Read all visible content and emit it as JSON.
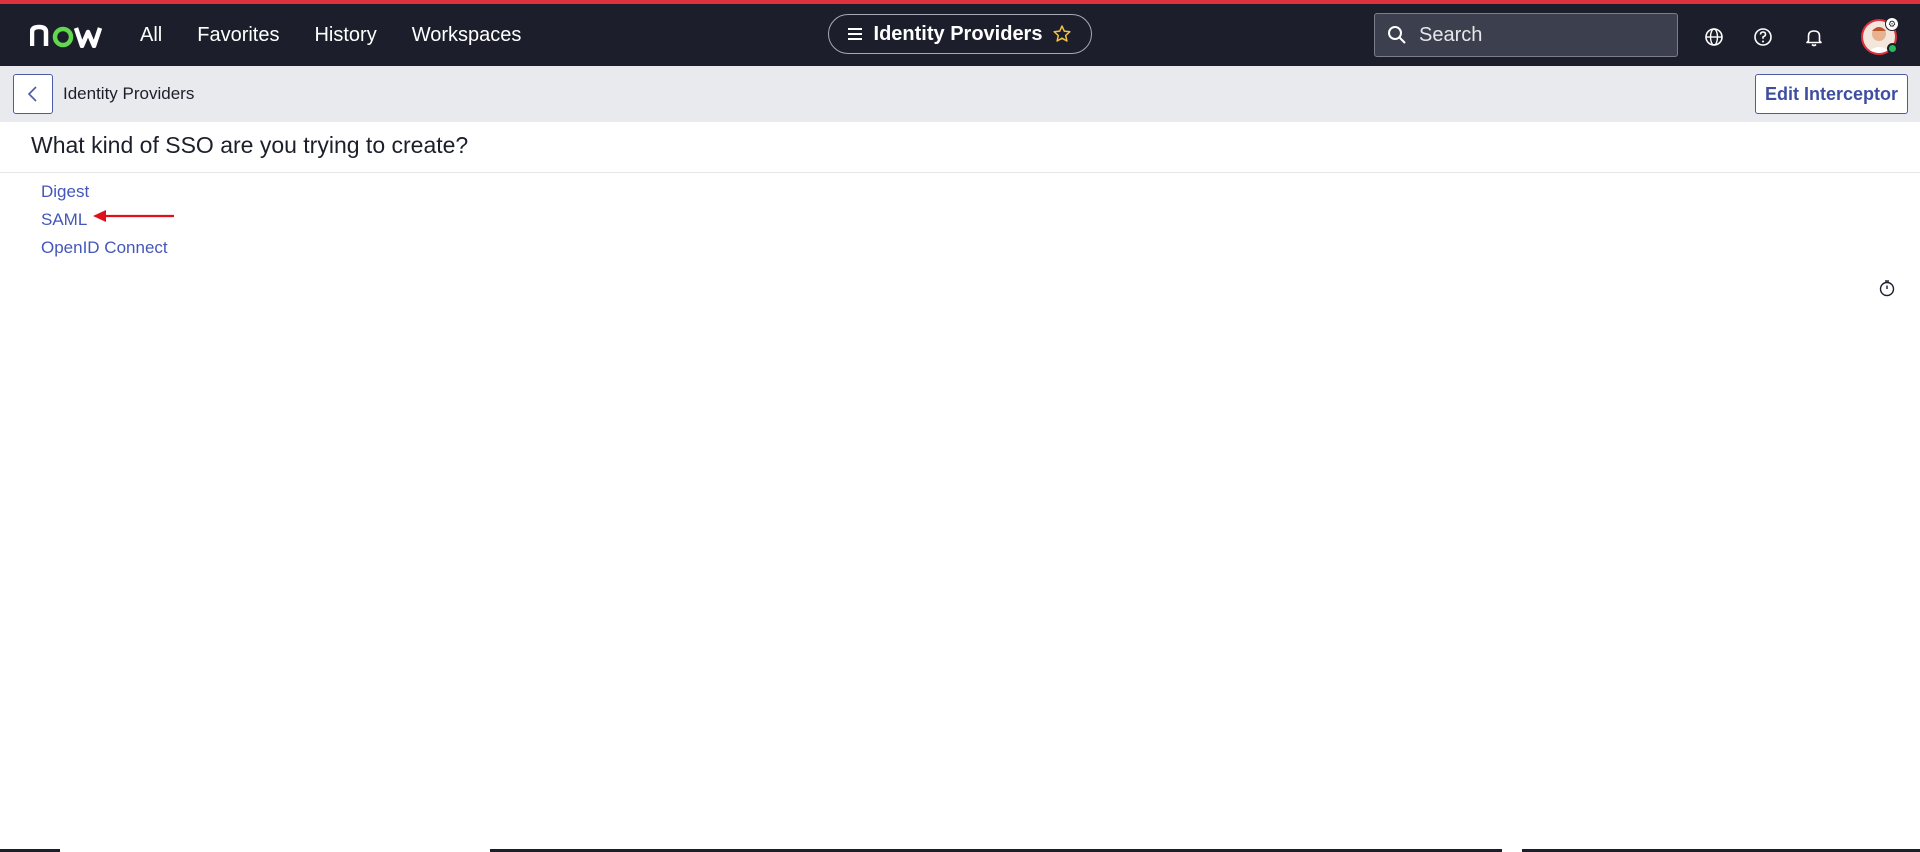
{
  "topbar": {
    "logo_text": "now",
    "nav": [
      "All",
      "Favorites",
      "History",
      "Workspaces"
    ],
    "page_title": "Identity Providers",
    "search_placeholder": "Search",
    "accent_color": "#e0313f",
    "bar_color": "#1c1f2b"
  },
  "subbar": {
    "breadcrumb": "Identity Providers",
    "edit_button": "Edit Interceptor"
  },
  "main": {
    "question": "What kind of SSO are you trying to create?",
    "options": [
      "Digest",
      "SAML",
      "OpenID Connect"
    ],
    "link_color": "#4457b8"
  },
  "annotation": {
    "arrow_target": "SAML",
    "arrow_color": "#e0101a"
  },
  "icons": [
    "list-icon",
    "star-icon",
    "search-icon",
    "globe-icon",
    "help-icon",
    "bell-icon",
    "avatar",
    "back-chevron-icon",
    "timer-icon"
  ]
}
